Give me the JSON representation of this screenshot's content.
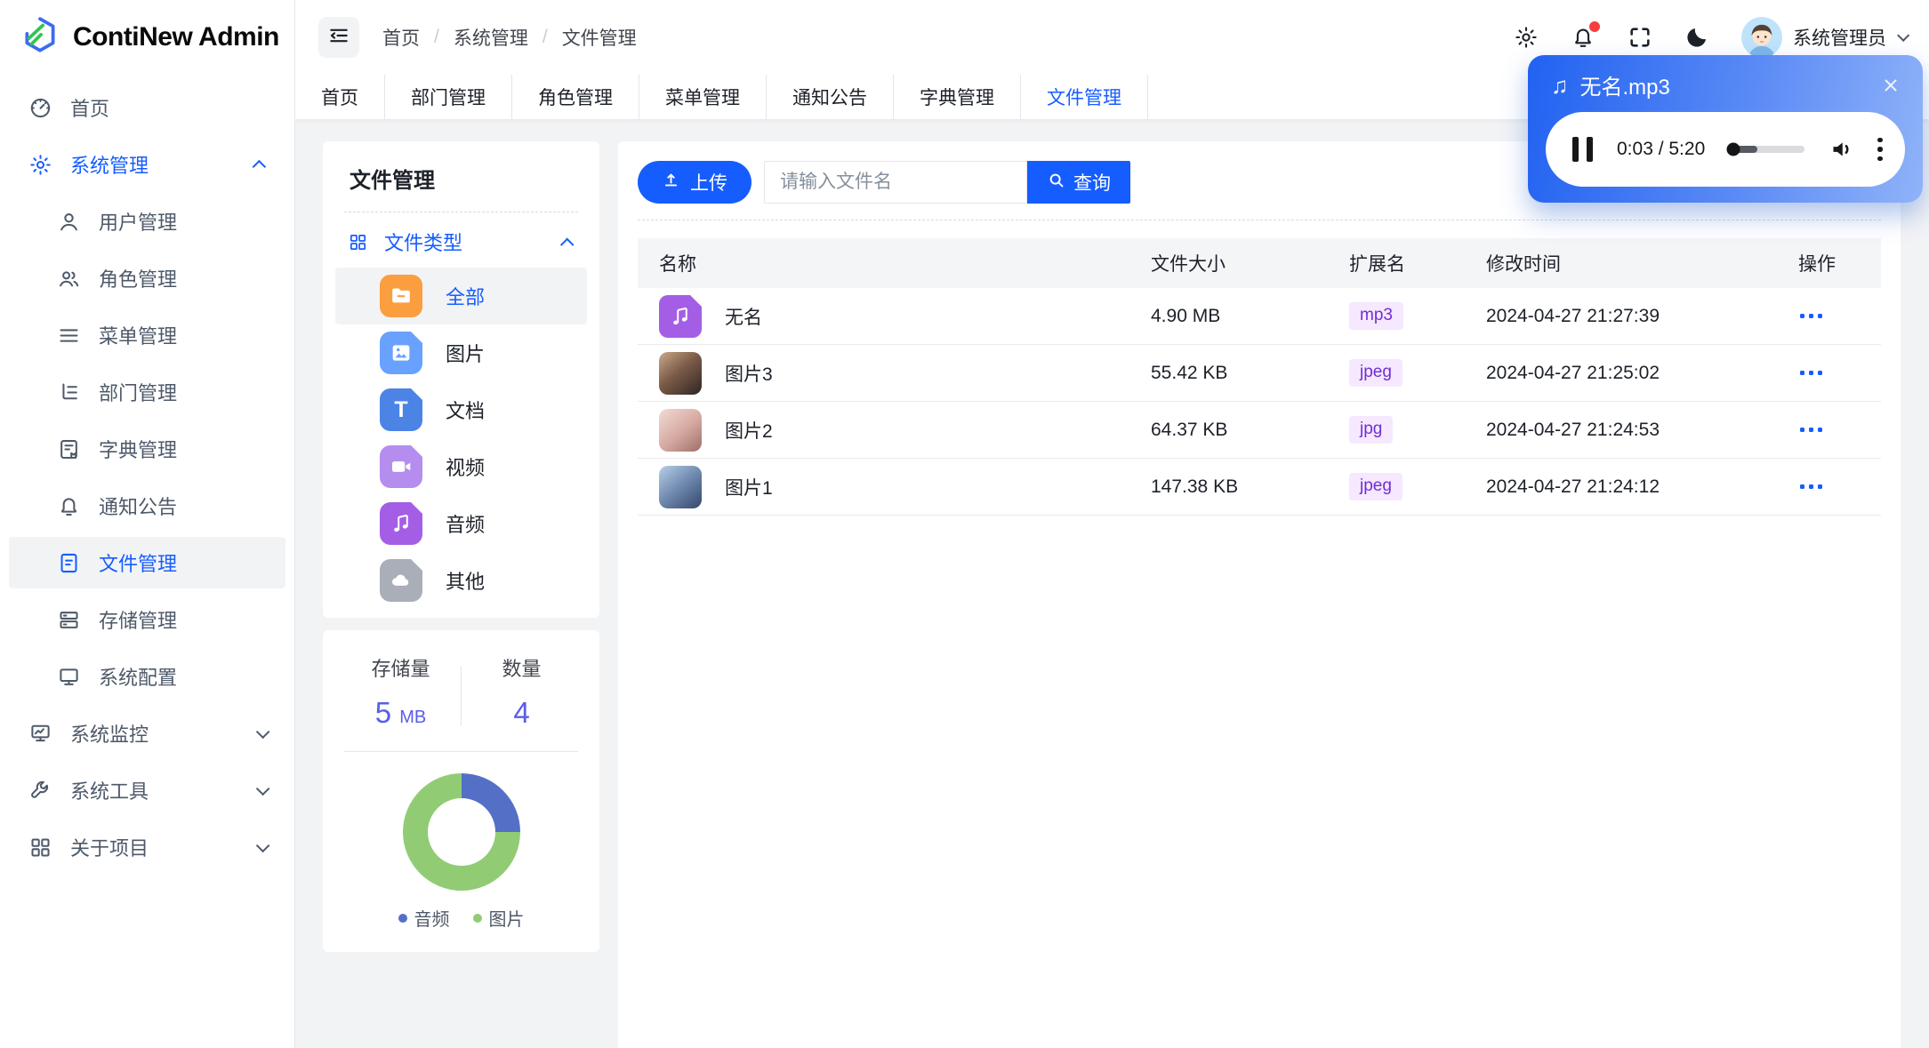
{
  "brand": {
    "name": "ContiNew Admin"
  },
  "topbar": {
    "breadcrumb": [
      "首页",
      "系统管理",
      "文件管理"
    ],
    "separator": "/",
    "user_name": "系统管理员",
    "notification_badge": true
  },
  "tabs": {
    "items": [
      {
        "key": "home",
        "label": "首页",
        "active": false
      },
      {
        "key": "dept",
        "label": "部门管理",
        "active": false
      },
      {
        "key": "role",
        "label": "角色管理",
        "active": false
      },
      {
        "key": "menu",
        "label": "菜单管理",
        "active": false
      },
      {
        "key": "notice",
        "label": "通知公告",
        "active": false
      },
      {
        "key": "dict",
        "label": "字典管理",
        "active": false
      },
      {
        "key": "file",
        "label": "文件管理",
        "active": true
      }
    ]
  },
  "sidebar": {
    "items": [
      {
        "key": "home",
        "label": "首页",
        "icon": "dashboard",
        "level": 0
      },
      {
        "key": "system-management",
        "label": "系统管理",
        "icon": "gear",
        "level": 0,
        "highlight": true,
        "chevron": "up"
      },
      {
        "key": "user-management",
        "label": "用户管理",
        "icon": "user",
        "level": 1
      },
      {
        "key": "role-management",
        "label": "角色管理",
        "icon": "users",
        "level": 1
      },
      {
        "key": "menu-management",
        "label": "菜单管理",
        "icon": "menu-lines",
        "level": 1
      },
      {
        "key": "dept-management",
        "label": "部门管理",
        "icon": "tree-list",
        "level": 1
      },
      {
        "key": "dict-management",
        "label": "字典管理",
        "icon": "dictionary",
        "level": 1
      },
      {
        "key": "notice",
        "label": "通知公告",
        "icon": "bell",
        "level": 1
      },
      {
        "key": "file-management",
        "label": "文件管理",
        "icon": "file",
        "level": 1,
        "selected": true
      },
      {
        "key": "storage-management",
        "label": "存储管理",
        "icon": "storage",
        "level": 1
      },
      {
        "key": "system-config",
        "label": "系统配置",
        "icon": "monitor",
        "level": 1
      },
      {
        "key": "system-monitor",
        "label": "系统监控",
        "icon": "monitor-chart",
        "level": 0,
        "chevron": "down"
      },
      {
        "key": "system-tools",
        "label": "系统工具",
        "icon": "wrench",
        "level": 0,
        "chevron": "down"
      },
      {
        "key": "about-project",
        "label": "关于项目",
        "icon": "grid",
        "level": 0,
        "chevron": "down"
      }
    ]
  },
  "file_panel": {
    "title": "文件管理",
    "group": {
      "label": "文件类型",
      "icon": "grid",
      "expanded": true
    },
    "types": [
      {
        "key": "all",
        "label": "全部",
        "icon": "folder",
        "color": "#FB9E3F",
        "selected": true
      },
      {
        "key": "image",
        "label": "图片",
        "icon": "image",
        "color": "#69A1FF",
        "selected": false
      },
      {
        "key": "document",
        "label": "文档",
        "icon": "text",
        "color": "#4C84E6",
        "selected": false
      },
      {
        "key": "video",
        "label": "视频",
        "icon": "video",
        "color": "#B48DEF",
        "selected": false
      },
      {
        "key": "audio",
        "label": "音频",
        "icon": "music",
        "color": "#A45EE5",
        "selected": false
      },
      {
        "key": "other",
        "label": "其他",
        "icon": "cloud",
        "color": "#A9AEB8",
        "selected": false
      }
    ]
  },
  "stats": {
    "storage_label": "存储量",
    "storage_value": "5",
    "storage_unit": "MB",
    "count_label": "数量",
    "count_value": "4",
    "value_color": "#5A5EE8"
  },
  "chart_data": {
    "type": "pie",
    "subtype": "donut",
    "categories": [
      "音频",
      "图片"
    ],
    "values": [
      1,
      3
    ],
    "colors": [
      "#5470C6",
      "#91CC75"
    ],
    "legend_position": "bottom"
  },
  "toolbar": {
    "upload_label": "上传",
    "search_placeholder": "请输入文件名",
    "query_label": "查询"
  },
  "table": {
    "columns": [
      "名称",
      "文件大小",
      "扩展名",
      "修改时间",
      "操作"
    ],
    "rows": [
      {
        "name": "无名",
        "thumb": "music",
        "size": "4.90 MB",
        "ext": "mp3",
        "time": "2024-04-27 21:27:39"
      },
      {
        "name": "图片3",
        "thumb": "photo-warm",
        "size": "55.42 KB",
        "ext": "jpeg",
        "time": "2024-04-27 21:25:02"
      },
      {
        "name": "图片2",
        "thumb": "photo-pink",
        "size": "64.37 KB",
        "ext": "jpg",
        "time": "2024-04-27 21:24:53"
      },
      {
        "name": "图片1",
        "thumb": "photo-blue",
        "size": "147.38 KB",
        "ext": "jpeg",
        "time": "2024-04-27 21:24:12"
      }
    ]
  },
  "player": {
    "title": "无名.mp3",
    "time": "0:03 / 5:20",
    "progress_percent": 7,
    "buffered_percent": 38
  },
  "colors": {
    "primary": "#165DFF",
    "badge_bg": "#F5E8FF",
    "badge_text": "#722ED1"
  }
}
